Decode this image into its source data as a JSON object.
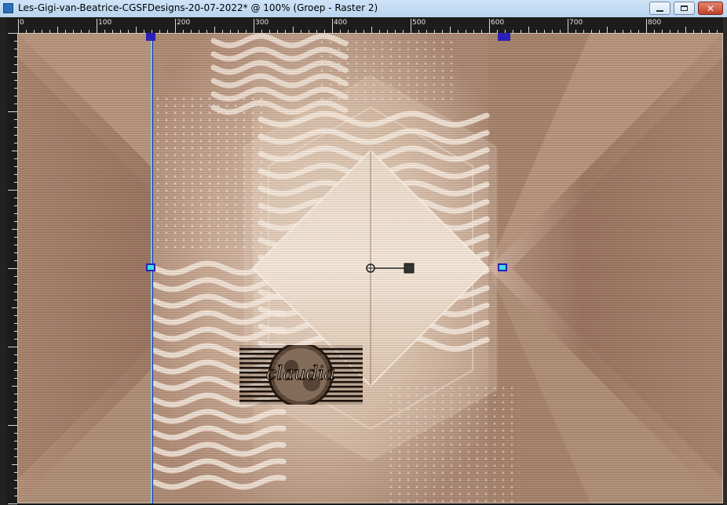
{
  "window": {
    "title": "Les-Gigi-van-Beatrice-CGSFDesigns-20-07-2022* @ 100% (Groep - Raster 2)",
    "icon": "app-document-icon"
  },
  "ruler": {
    "labels": [
      "0",
      "100",
      "200",
      "300",
      "400",
      "500",
      "600",
      "700",
      "800"
    ]
  },
  "canvas": {
    "watermark_text": "claudia",
    "colors": {
      "tan": "#a07c65",
      "light": "#e8d6c6",
      "dark": "#6e4a38",
      "guide_cyan": "#3ee0e6",
      "guide_blue": "#2a1fb8"
    }
  }
}
